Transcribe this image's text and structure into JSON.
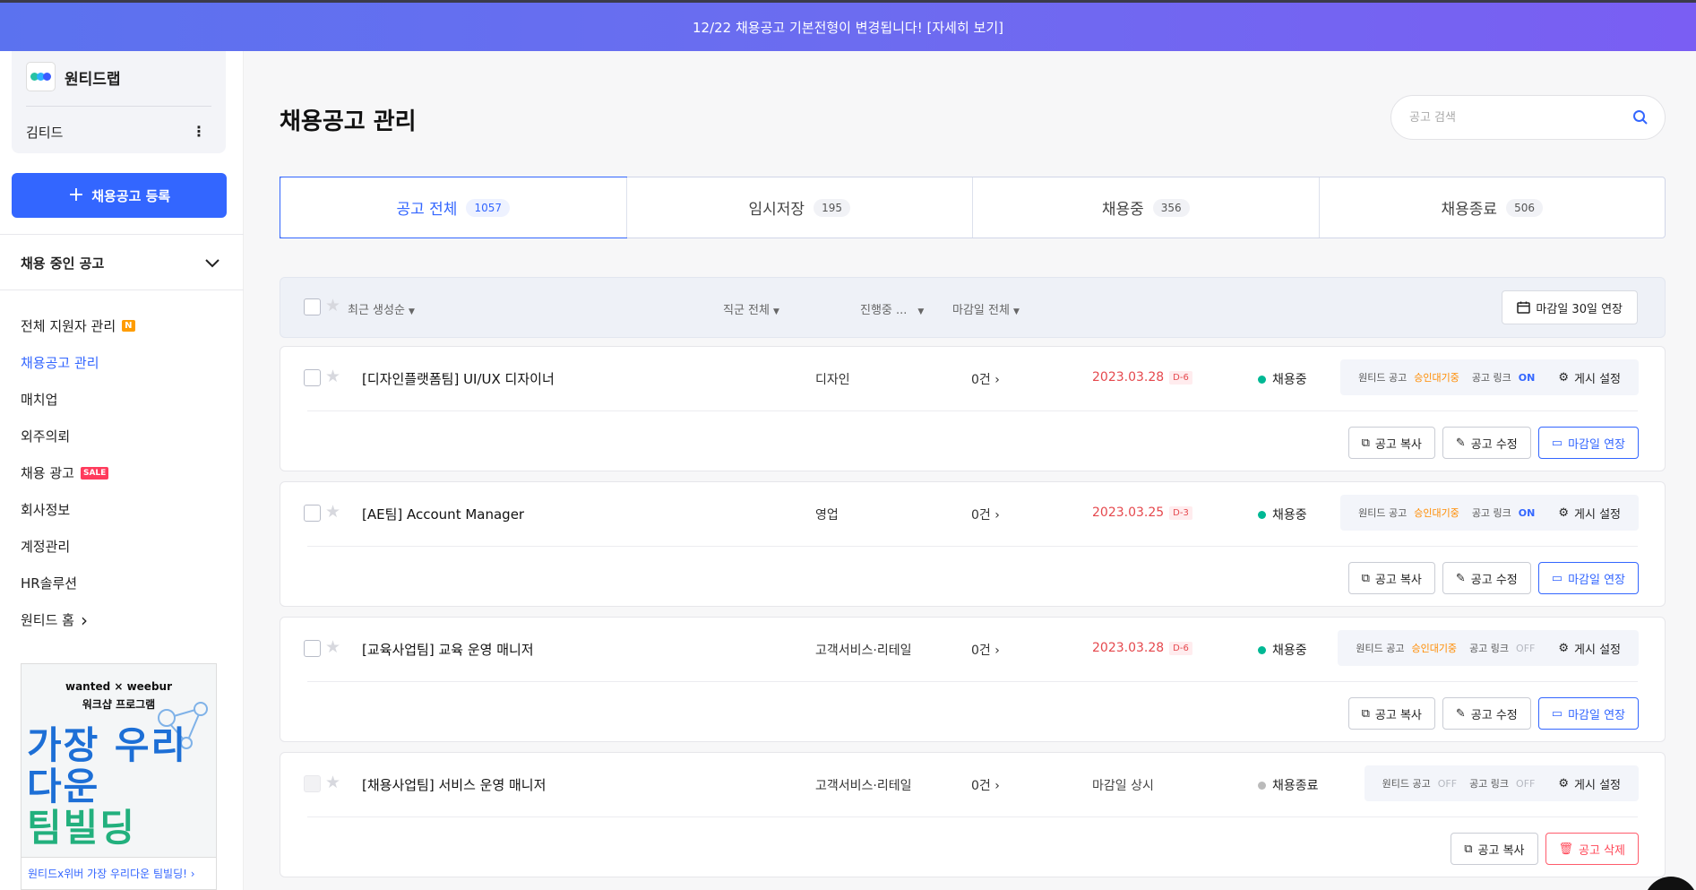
{
  "banner": {
    "text": "12/22 채용공고 기본전형이 변경됩니다! [자세히 보기]"
  },
  "sidebar": {
    "company": "원티드랩",
    "user": "김티드",
    "kebab": "⋮",
    "register_button": "채용공고 등록",
    "section_title": "채용 중인 공고",
    "items": [
      {
        "label": "전체 지원자 관리",
        "badge": "N"
      },
      {
        "label": "채용공고 관리"
      },
      {
        "label": "매치업"
      },
      {
        "label": "외주의뢰"
      },
      {
        "label": "채용 광고",
        "badge": "SALE"
      },
      {
        "label": "회사정보"
      },
      {
        "label": "계정관리"
      },
      {
        "label": "HR솔루션"
      },
      {
        "label": "원티드 홈",
        "arrow": "›"
      }
    ],
    "promo": {
      "logo": "wanted × weebur",
      "subtitle": "워크샵 프로그램",
      "line1": "가장 우리다운",
      "line2": "팀빌딩",
      "footer": "원티드x위버 가장 우리다운 팀빌딩! ›"
    }
  },
  "main": {
    "title": "채용공고 관리",
    "search_placeholder": "공고 검색",
    "tabs": [
      {
        "label": "공고 전체",
        "count": "1057"
      },
      {
        "label": "임시저장",
        "count": "195"
      },
      {
        "label": "채용중",
        "count": "356"
      },
      {
        "label": "채용종료",
        "count": "506"
      }
    ],
    "filters": {
      "sort": "최근 생성순",
      "job": "직군 전체",
      "progress": "진행중 ...",
      "deadline": "마감일 전체",
      "extend_all": "마감일 30일 연장"
    },
    "postings": [
      {
        "title": "[디자인플랫폼팀] UI/UX 디자이너",
        "job": "디자인",
        "count": "0건",
        "deadline": "2023.03.28",
        "dday": "D-6",
        "status": "채용중",
        "wanted_label": "원티드 공고",
        "wanted_value": "승인대기중",
        "link_label": "공고 링크",
        "link_value": "ON",
        "setting": "게시 설정",
        "copy": "공고 복사",
        "edit": "공고 수정",
        "extend": "마감일 연장"
      },
      {
        "title": "[AE팀] Account Manager",
        "job": "영업",
        "count": "0건",
        "deadline": "2023.03.25",
        "dday": "D-3",
        "status": "채용중",
        "wanted_label": "원티드 공고",
        "wanted_value": "승인대기중",
        "link_label": "공고 링크",
        "link_value": "ON",
        "setting": "게시 설정",
        "copy": "공고 복사",
        "edit": "공고 수정",
        "extend": "마감일 연장"
      },
      {
        "title": "[교육사업팀] 교육 운영 매니저",
        "job": "고객서비스·리테일",
        "count": "0건",
        "deadline": "2023.03.28",
        "dday": "D-6",
        "status": "채용중",
        "wanted_label": "원티드 공고",
        "wanted_value": "승인대기중",
        "link_label": "공고 링크",
        "link_value": "OFF",
        "setting": "게시 설정",
        "copy": "공고 복사",
        "edit": "공고 수정",
        "extend": "마감일 연장"
      },
      {
        "title": "[채용사업팀] 서비스 운영 매니저",
        "job": "고객서비스·리테일",
        "count": "0건",
        "deadline": "마감일 상시",
        "status": "채용종료",
        "wanted_label": "원티드 공고",
        "wanted_value": "OFF",
        "link_label": "공고 링크",
        "link_value": "OFF",
        "setting": "게시 설정",
        "copy": "공고 복사",
        "delete": "공고 삭제"
      }
    ]
  },
  "colors": {
    "accent": "#3366ff",
    "status_active": "#00b894",
    "status_closed": "#bbbbbb",
    "deadline": "#e5484d"
  }
}
